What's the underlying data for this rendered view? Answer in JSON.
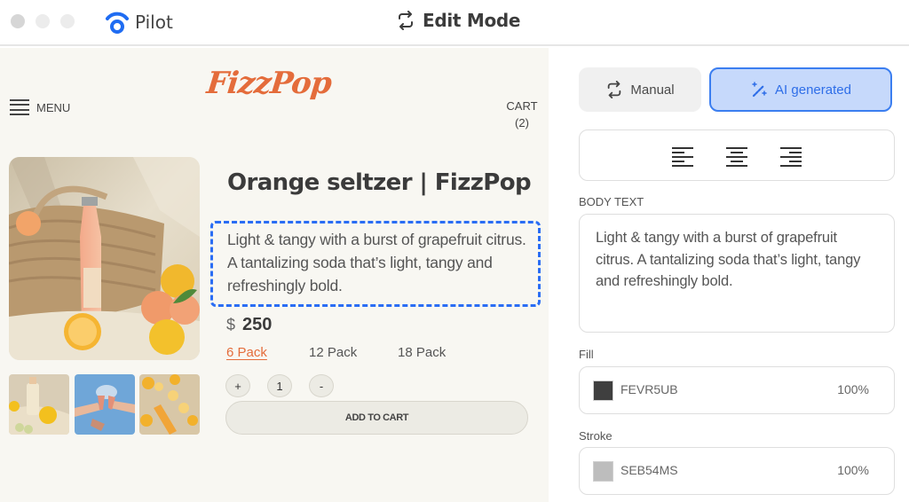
{
  "titlebar": {
    "app_name": "Pilot",
    "mode_label": "Edit Mode",
    "mode_icon": "repeat-arrows-icon",
    "app_icon": "wifi-signal-logo-icon"
  },
  "store": {
    "brand": "FizzPop",
    "brand_color": "#e46c3b",
    "menu_label": "MENU",
    "cart_label": "CART",
    "cart_count": "(2)",
    "product": {
      "title": "Orange seltzer | FizzPop",
      "description": "Light & tangy with a burst of grapefruit citrus. A tantalizing soda that’s light, tangy and refreshingly bold.",
      "currency": "$",
      "price": "250",
      "packs": [
        {
          "label": "6 Pack",
          "selected": true
        },
        {
          "label": "12 Pack",
          "selected": false
        },
        {
          "label": "18 Pack",
          "selected": false
        }
      ],
      "quantity": "1",
      "plus_label": "+",
      "minus_label": "-",
      "add_to_cart_label": "ADD TO CART"
    },
    "images": {
      "main": "product-photo-bottle-bag-oranges",
      "thumbnails": [
        "thumbnail-bottle-lemons",
        "thumbnail-toast-sky",
        "thumbnail-bottle-citrus-flatlay"
      ]
    }
  },
  "panel": {
    "mode_toggle": {
      "manual_label": "Manual",
      "ai_label": "AI generated",
      "active": "AI generated",
      "accent_color": "#3b7ef0"
    },
    "alignment": [
      "align-left",
      "align-center",
      "align-right"
    ],
    "body_text_label": "BODY TEXT",
    "body_text_value": "Light & tangy with a burst of grapefruit citrus. A tantalizing soda that’s light, tangy and refreshingly bold.",
    "fill": {
      "label": "Fill",
      "code": "FEVR5UB",
      "opacity": "100%",
      "swatch_color": "#3f3f3f"
    },
    "stroke": {
      "label": "Stroke",
      "code": "SEB54MS",
      "opacity": "100%",
      "swatch_color": "#bdbdbd"
    }
  }
}
